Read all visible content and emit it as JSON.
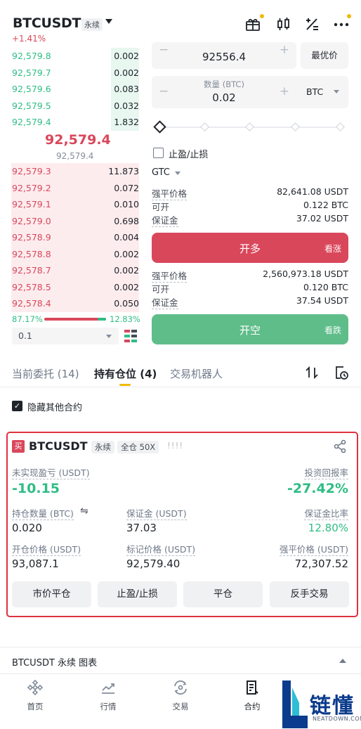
{
  "header": {
    "symbol": "BTCUSDT",
    "contract_type": "永续",
    "change": "+1.41%"
  },
  "orderbook": {
    "bids": [
      {
        "price": "92,579.8",
        "qty": "0.002"
      },
      {
        "price": "92,579.7",
        "qty": "0.002"
      },
      {
        "price": "92,579.6",
        "qty": "0.083"
      },
      {
        "price": "92,579.5",
        "qty": "0.032"
      },
      {
        "price": "92,579.4",
        "qty": "1.832"
      }
    ],
    "last_price": "92,579.4",
    "mark_price": "92,579.4",
    "asks": [
      {
        "price": "92,579.3",
        "qty": "11.873"
      },
      {
        "price": "92,579.2",
        "qty": "0.072"
      },
      {
        "price": "92,579.1",
        "qty": "0.010"
      },
      {
        "price": "92,579.0",
        "qty": "0.698"
      },
      {
        "price": "92,578.9",
        "qty": "0.004"
      },
      {
        "price": "92,578.8",
        "qty": "0.002"
      },
      {
        "price": "92,578.7",
        "qty": "0.002"
      },
      {
        "price": "92,578.5",
        "qty": "0.002"
      },
      {
        "price": "92,578.4",
        "qty": "0.050"
      }
    ],
    "buy_ratio": "87.17%",
    "sell_ratio": "12.83%",
    "depth": "0.1"
  },
  "order_form": {
    "minus": "−",
    "plus": "+",
    "price": "92556.4",
    "best_price": "最优价",
    "qty_label": "数量 (BTC)",
    "qty": "0.02",
    "unit": "BTC",
    "tpsl_label": "止盈/止损",
    "tif": "GTC",
    "long_info": [
      {
        "label": "强平价格",
        "value": "82,641.08 USDT"
      },
      {
        "label": "可开",
        "value": "0.122 BTC"
      },
      {
        "label": "保证金",
        "value": "37.02 USDT"
      }
    ],
    "long_btn": "开多",
    "long_sub": "看涨",
    "short_info": [
      {
        "label": "强平价格",
        "value": "2,560,973.18 USDT"
      },
      {
        "label": "可开",
        "value": "0.120 BTC"
      },
      {
        "label": "保证金",
        "value": "37.54 USDT"
      }
    ],
    "short_btn": "开空",
    "short_sub": "看跌"
  },
  "tabs": {
    "open_orders": "当前委托 (14)",
    "positions": "持有仓位 (4)",
    "bots": "交易机器人"
  },
  "hide_other": "隐藏其他合约",
  "position": {
    "side": "买",
    "symbol": "BTCUSDT",
    "type": "永续",
    "margin_mode": "全仓 50X",
    "bars": "!!!!",
    "upnl_label": "未实现盈亏 (USDT)",
    "upnl": "-10.15",
    "roi_label": "投资回报率",
    "roi": "-27.42%",
    "size_label": "持仓数量 (BTC)",
    "swap_glyph": "⇋",
    "size": "0.020",
    "margin_label": "保证金 (USDT)",
    "margin": "37.03",
    "margin_ratio_label": "保证金比率",
    "margin_ratio": "12.80%",
    "entry_label": "开仓价格 (USDT)",
    "entry": "93,087.1",
    "mark_label": "标记价格 (USDT)",
    "mark": "92,579.40",
    "liq_label": "强平价格 (USDT)",
    "liq": "72,307.52",
    "btn_market_close": "市价平仓",
    "btn_tpsl": "止盈/止损",
    "btn_close": "平仓",
    "btn_reverse": "反手交易"
  },
  "chart_bar": "BTCUSDT 永续 图表",
  "nav": {
    "home": "首页",
    "markets": "行情",
    "trade": "交易",
    "futures": "合约"
  },
  "watermark": {
    "text": "链懂",
    "sub": "NEATDOWN.COM"
  },
  "colors": {
    "red": "#d9475b",
    "green": "#2ebd85",
    "accent": "#f0b90b",
    "highlight_border": "#e0313f"
  }
}
